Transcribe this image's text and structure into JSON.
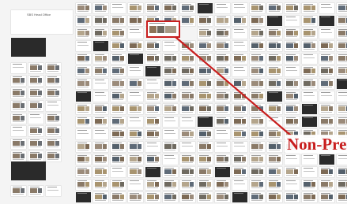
{
  "collage": {
    "title_slide": {
      "title": "SBS Head Office",
      "subtitle": ""
    }
  },
  "callout": {
    "label": "Non-Pres",
    "color": "#c81e1e"
  }
}
